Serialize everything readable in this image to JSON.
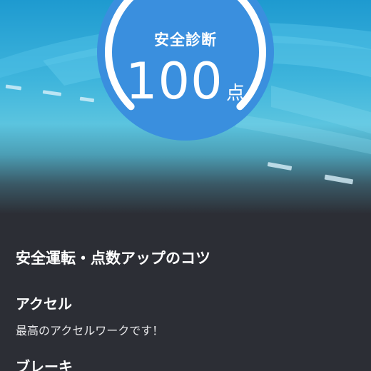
{
  "diagnosis": {
    "title": "安全診断",
    "score": "100",
    "unit": "点",
    "fraction": 1.0
  },
  "tips": {
    "title": "安全運転・点数アップのコツ",
    "items": [
      {
        "heading": "アクセル",
        "text": "最高のアクセルワークです！"
      },
      {
        "heading": "ブレーキ",
        "text": ""
      }
    ]
  },
  "colors": {
    "gauge_fill": "#3a8fde",
    "background_dark": "#2c2e35",
    "sky": "#1e9ad0"
  }
}
